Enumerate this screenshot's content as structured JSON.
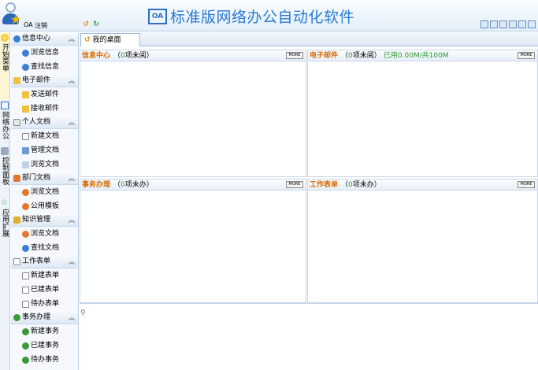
{
  "header": {
    "oa_label": "OA",
    "logout": "注销",
    "logo_text": "OA",
    "title": "标准版网络办公自动化软件"
  },
  "vtabs": [
    {
      "label": "开始菜单",
      "icon": "bulb-icon"
    },
    {
      "label": "网络办公",
      "icon": "oa-icon"
    },
    {
      "label": "控制面板",
      "icon": "wrench-icon"
    },
    {
      "label": "应用扩展",
      "icon": "star-icon"
    }
  ],
  "sidebar": {
    "groups": [
      {
        "label": "信息中心",
        "items": [
          "浏览信息",
          "查找信息"
        ]
      },
      {
        "label": "电子邮件",
        "items": [
          "发送邮件",
          "接收邮件"
        ]
      },
      {
        "label": "个人文档",
        "items": [
          "新建文档",
          "管理文档",
          "浏览文档"
        ]
      },
      {
        "label": "部门文档",
        "items": [
          "浏览文档",
          "公用模板"
        ]
      },
      {
        "label": "知识管理",
        "items": [
          "浏览文档",
          "查找文档"
        ]
      },
      {
        "label": "工作表单",
        "items": [
          "新建表单",
          "已建表单",
          "待办表单"
        ]
      },
      {
        "label": "事务办理",
        "items": [
          "新建事务",
          "已建事务",
          "待办事务"
        ]
      }
    ]
  },
  "main": {
    "tab_label": "我的桌面",
    "more": "MORE",
    "panels": [
      {
        "title": "信息中心",
        "prefix": "（",
        "count": "0",
        "suffix": " 项未阅）",
        "quota": ""
      },
      {
        "title": "电子邮件",
        "prefix": "（",
        "count": "0",
        "suffix": " 项未阅）",
        "quota": "已用0.00M/共100M"
      },
      {
        "title": "事务办理",
        "prefix": "（",
        "count": "0",
        "suffix": " 项未办）",
        "quota": ""
      },
      {
        "title": "工作表单",
        "prefix": "（",
        "count": "0",
        "suffix": " 项未办）",
        "quota": ""
      }
    ]
  },
  "colors": {
    "accent": "#2a7ad2",
    "panel_title": "#d86a00",
    "count": "#2b9a2b"
  }
}
